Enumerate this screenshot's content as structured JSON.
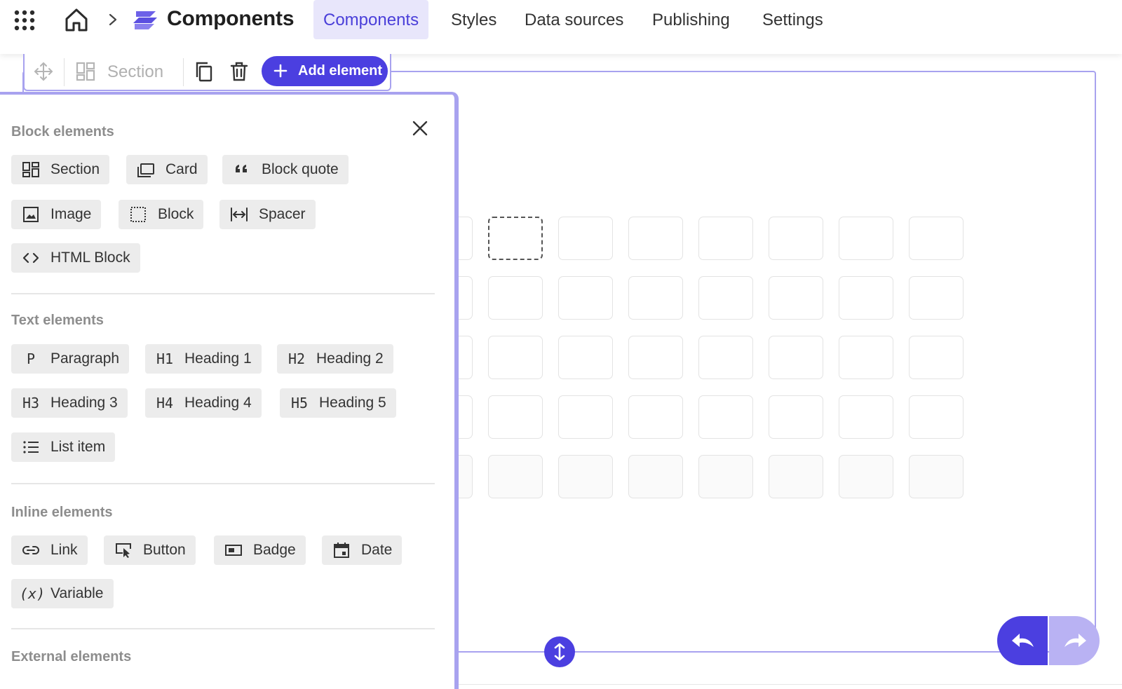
{
  "header": {
    "apps_icon": "apps-grid-icon",
    "home_icon": "home-icon",
    "app_title": "Components",
    "tabs": [
      {
        "label": "Components",
        "active": true
      },
      {
        "label": "Styles",
        "active": false
      },
      {
        "label": "Data sources",
        "active": false
      },
      {
        "label": "Publishing",
        "active": false
      },
      {
        "label": "Settings",
        "active": false
      }
    ]
  },
  "toolbar": {
    "element_type": "Section",
    "add_label": "Add element"
  },
  "panel": {
    "groups": [
      {
        "title": "Block elements",
        "items": [
          {
            "label": "Section",
            "icon": "section-icon"
          },
          {
            "label": "Card",
            "icon": "card-icon"
          },
          {
            "label": "Block quote",
            "icon": "quote-icon"
          },
          {
            "label": "Image",
            "icon": "image-icon"
          },
          {
            "label": "Block",
            "icon": "block-icon"
          },
          {
            "label": "Spacer",
            "icon": "spacer-icon"
          },
          {
            "label": "HTML Block",
            "icon": "code-icon"
          }
        ]
      },
      {
        "title": "Text elements",
        "items": [
          {
            "label": "Paragraph",
            "glyph": "P"
          },
          {
            "label": "Heading 1",
            "glyph": "H1"
          },
          {
            "label": "Heading 2",
            "glyph": "H2"
          },
          {
            "label": "Heading 3",
            "glyph": "H3"
          },
          {
            "label": "Heading 4",
            "glyph": "H4"
          },
          {
            "label": "Heading 5",
            "glyph": "H5"
          },
          {
            "label": "List item",
            "icon": "list-icon"
          }
        ]
      },
      {
        "title": "Inline elements",
        "items": [
          {
            "label": "Link",
            "icon": "link-icon"
          },
          {
            "label": "Button",
            "icon": "button-icon"
          },
          {
            "label": "Badge",
            "icon": "badge-icon"
          },
          {
            "label": "Date",
            "icon": "calendar-icon"
          },
          {
            "label": "Variable",
            "glyph": "(x)"
          }
        ]
      },
      {
        "title": "External elements",
        "items": []
      }
    ]
  },
  "colors": {
    "accent": "#4b3fe0",
    "accent_light": "#e8e6fb",
    "frame": "#a8a2ef",
    "chip_bg": "#ececec"
  }
}
